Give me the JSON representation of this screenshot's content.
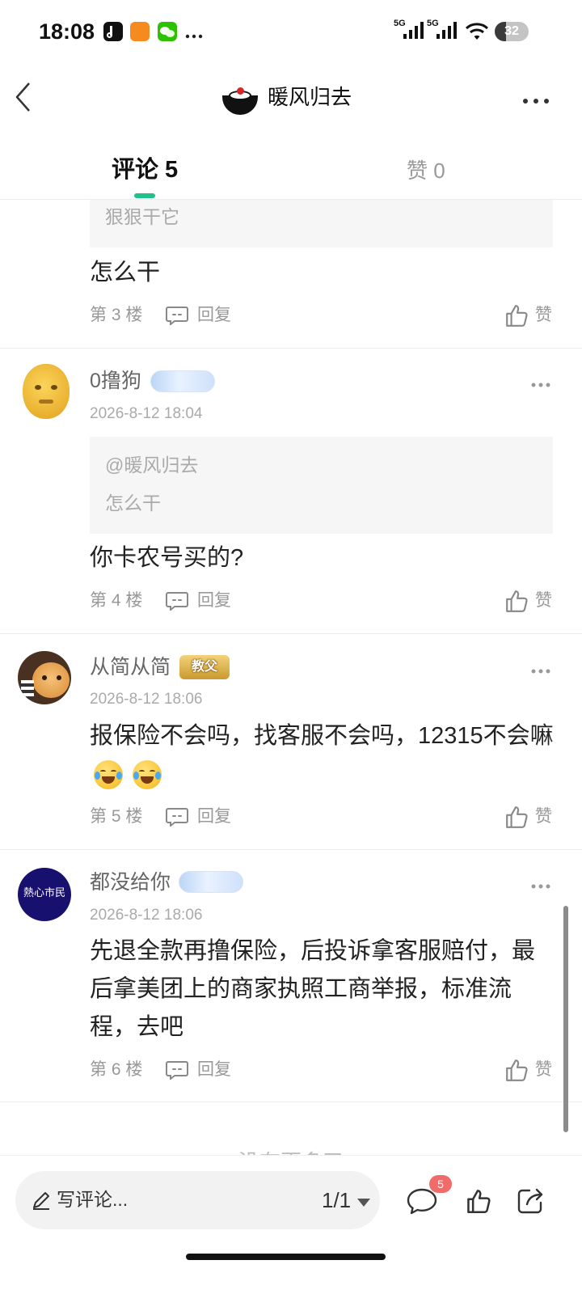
{
  "status_bar": {
    "time": "18:08",
    "network_1": "5G",
    "network_2": "5G",
    "battery": "32"
  },
  "header": {
    "title": "暖风归去"
  },
  "tabs": [
    {
      "label": "评论 5"
    },
    {
      "label": "赞 0"
    }
  ],
  "comments": [
    {
      "quote_text": "狠狠干它",
      "content": "怎么干",
      "floor": "第 3 楼",
      "reply": "回复",
      "like": "赞"
    },
    {
      "name": "0撸狗",
      "date": "2026-8-12 18:04",
      "quote_user": "@暖风归去",
      "quote_text": "怎么干",
      "content": "你卡农号买的?",
      "floor": "第 4 楼",
      "reply": "回复",
      "like": "赞"
    },
    {
      "name": "从简从简",
      "badge": "教父",
      "date": "2026-8-12 18:06",
      "content": "报保险不会吗，找客服不会吗，12315不会嘛",
      "floor": "第 5 楼",
      "reply": "回复",
      "like": "赞"
    },
    {
      "name": "都没给你",
      "avatar_text": "熱心市民",
      "date": "2026-8-12 18:06",
      "content_lines": [
        "先退全款再撸保险，后投诉拿客服赔付，最",
        "后拿美团上的商家执照工商举报，标准流",
        "程，去吧"
      ],
      "floor": "第 6 楼",
      "reply": "回复",
      "like": "赞"
    }
  ],
  "list_end": "没有更多了",
  "bottom_bar": {
    "placeholder": "写评论...",
    "page": "1/1",
    "comment_count": "5"
  },
  "colors": {
    "accent": "#22c08a",
    "badge_red": "#f26b6b",
    "quote_bg": "#f6f6f6"
  }
}
